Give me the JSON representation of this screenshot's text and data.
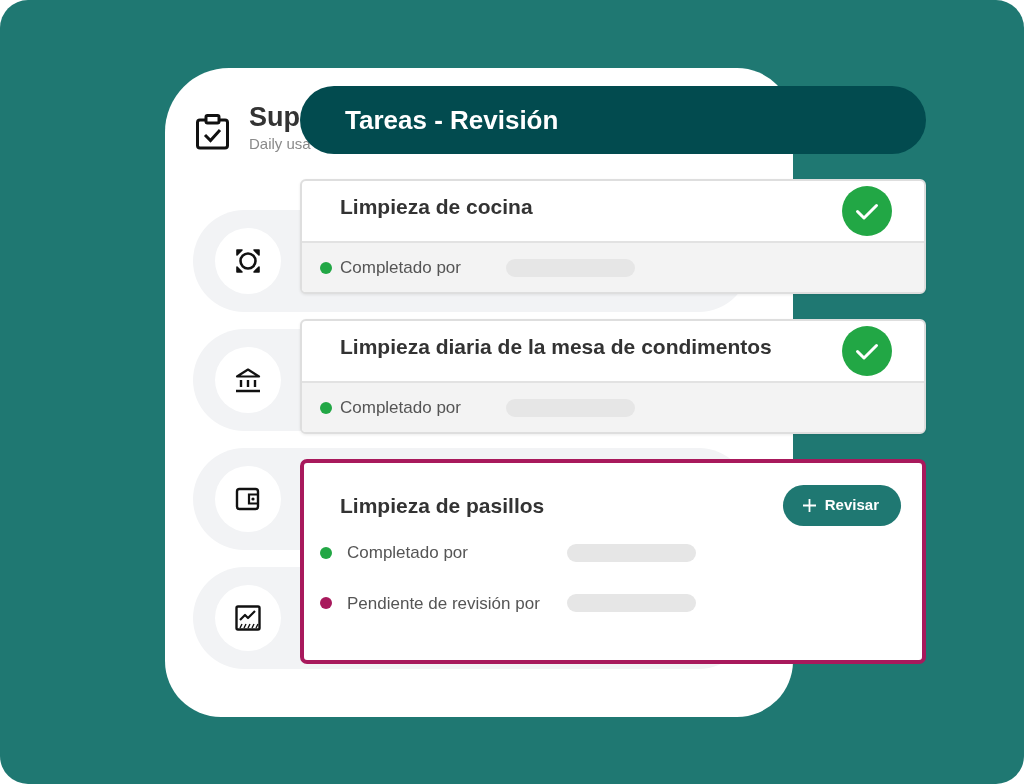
{
  "background_card": {
    "title": "Sup",
    "subtitle": "Daily usa"
  },
  "panel": {
    "title": "Tareas - Revisión"
  },
  "tasks": [
    {
      "title": "Limpieza de cocina",
      "done": true,
      "selected": false,
      "entries": [
        {
          "label": "Completado por",
          "color": "#22a745"
        }
      ]
    },
    {
      "title": "Limpieza diaria de la mesa de condimentos",
      "done": true,
      "selected": false,
      "entries": [
        {
          "label": "Completado por",
          "color": "#22a745"
        }
      ]
    },
    {
      "title": "Limpieza de pasillos",
      "done": false,
      "selected": true,
      "action": "Revisar",
      "entries": [
        {
          "label": "Completado por",
          "color": "#22a745"
        },
        {
          "label": "Pendiente de revisión por",
          "color": "#a8195c"
        }
      ]
    }
  ]
}
